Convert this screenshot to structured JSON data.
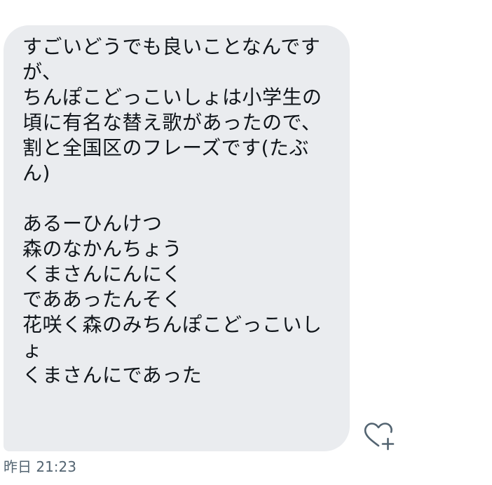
{
  "message": {
    "lines": [
      "すごいどうでも良いことなんです",
      "が、",
      "ちんぽこどっこいしょは小学生の",
      "頃に有名な替え歌があったので、",
      "割と全国区のフレーズです(たぶ",
      "ん)",
      "",
      "あるーひんけつ",
      "森のなかんちょう",
      "くまさんにんにく",
      "でああったんそく",
      "花咲く森のみちんぽこどっこいし",
      "ょ",
      "くまさんにであった"
    ],
    "timestamp": "昨日 21:23"
  },
  "icons": {
    "like": "heart-plus-icon"
  },
  "colors": {
    "bubble_bg": "#eaecef",
    "text": "#0f1419",
    "meta": "#536471",
    "icon": "#536471"
  }
}
